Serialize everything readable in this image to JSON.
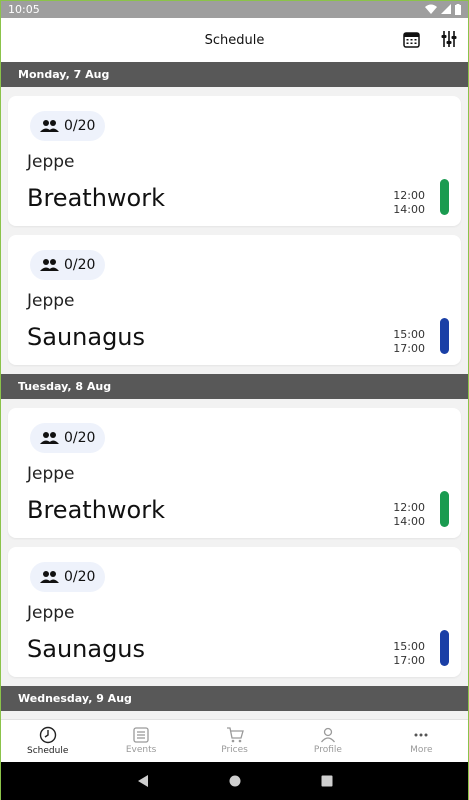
{
  "status_bar": {
    "time": "10:05"
  },
  "app_bar": {
    "title": "Schedule",
    "calendar_icon": "calendar-icon",
    "filter_icon": "sliders-icon"
  },
  "days": [
    {
      "label": "Monday, 7 Aug",
      "events": [
        {
          "capacity": "0/20",
          "instructor": "Jeppe",
          "name": "Breathwork",
          "start": "12:00",
          "end": "14:00",
          "color": "#1a9b50"
        },
        {
          "capacity": "0/20",
          "instructor": "Jeppe",
          "name": "Saunagus",
          "start": "15:00",
          "end": "17:00",
          "color": "#1a3fa6"
        }
      ]
    },
    {
      "label": "Tuesday, 8 Aug",
      "events": [
        {
          "capacity": "0/20",
          "instructor": "Jeppe",
          "name": "Breathwork",
          "start": "12:00",
          "end": "14:00",
          "color": "#1a9b50"
        },
        {
          "capacity": "0/20",
          "instructor": "Jeppe",
          "name": "Saunagus",
          "start": "15:00",
          "end": "17:00",
          "color": "#1a3fa6"
        }
      ]
    },
    {
      "label": "Wednesday, 9 Aug",
      "events": []
    }
  ],
  "bottom_nav": [
    {
      "label": "Schedule",
      "icon": "clock-icon",
      "active": true
    },
    {
      "label": "Events",
      "icon": "list-icon",
      "active": false
    },
    {
      "label": "Prices",
      "icon": "cart-icon",
      "active": false
    },
    {
      "label": "Profile",
      "icon": "person-icon",
      "active": false
    },
    {
      "label": "More",
      "icon": "more-dots-icon",
      "active": false
    }
  ],
  "colors": {
    "day_header_bg": "#585858",
    "badge_bg": "#eef2fb",
    "breathwork": "#1a9b50",
    "saunagus": "#1a3fa6"
  }
}
